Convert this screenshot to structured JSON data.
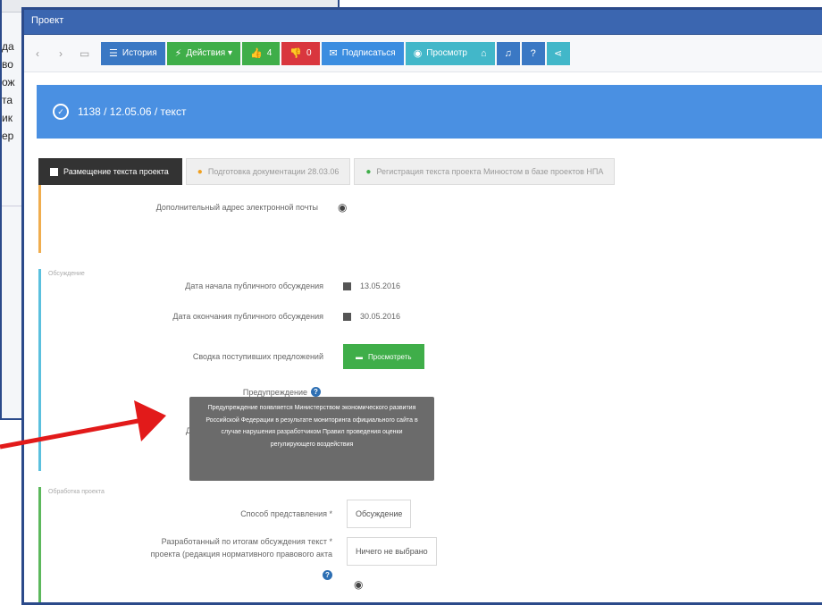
{
  "background_window": {
    "text_fragments": [
      "да",
      "во",
      "ож",
      "та",
      "ик",
      "ер"
    ]
  },
  "window": {
    "title": "Проект"
  },
  "toolbar": {
    "buttons": [
      {
        "label": "История",
        "icon": "list-icon"
      },
      {
        "label": "Действия ▾",
        "icon": "lightning-icon"
      },
      {
        "label": "4",
        "icon": "thumbs-up-icon"
      },
      {
        "label": "0",
        "icon": "thumbs-down-icon"
      },
      {
        "label": "Подписаться",
        "icon": "subscribe-icon"
      },
      {
        "label": "Просмотр",
        "icon": "eye-icon"
      }
    ]
  },
  "banner": {
    "text": "1138 / 12.05.06 / текст"
  },
  "steps": [
    {
      "label": "Размещение текста проекта"
    },
    {
      "label": "Подготовка документации 28.03.06"
    },
    {
      "label": "Регистрация текста проекта Минюстом в базе проектов НПА"
    }
  ],
  "section1": {
    "title": "",
    "label": "Дополнительный адрес электронной почты"
  },
  "section2": {
    "title": "Обсуждение",
    "rows": [
      {
        "label": "Дата начала публичного обсуждения",
        "value": "13.05.2016"
      },
      {
        "label": "Дата окончания публичного обсуждения",
        "value": "30.05.2016"
      },
      {
        "label": "Сводка поступивших предложений",
        "value": "Просмотреть"
      },
      {
        "label": "Предупреждение",
        "value": ""
      },
      {
        "label": "Д",
        "value": ""
      }
    ]
  },
  "tooltip": {
    "text": "Предупреждение появляется Министерством экономического развития Российской Федерации в результате мониторинга официального сайта в случае нарушения разработчиком Правил проведения оценки регулирующего воздействия"
  },
  "section3": {
    "title": "Обработка проекта",
    "rows": [
      {
        "label": "Способ представления *",
        "value": "Обсуждение"
      },
      {
        "label": "Разработанный по итогам обсуждения текст *",
        "label2": "проекта (редакция нормативного правового акта",
        "value": "Ничего не выбрано"
      }
    ]
  }
}
